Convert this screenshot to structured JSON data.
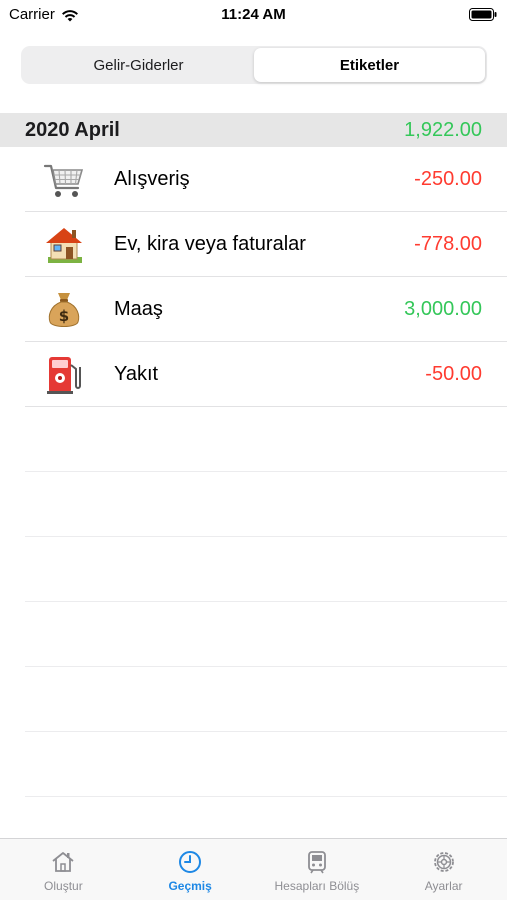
{
  "status_bar": {
    "carrier": "Carrier",
    "time": "11:24 AM"
  },
  "segments": [
    {
      "label": "Gelir-Giderler",
      "active": false
    },
    {
      "label": "Etiketler",
      "active": true
    }
  ],
  "section": {
    "title": "2020 April",
    "total": "1,922.00",
    "total_color": "#34c759"
  },
  "entries": [
    {
      "icon": "shopping-cart-icon",
      "label": "Alışveriş",
      "amount": "-250.00",
      "type": "negative"
    },
    {
      "icon": "house-icon",
      "label": "Ev, kira veya faturalar",
      "amount": "-778.00",
      "type": "negative"
    },
    {
      "icon": "money-bag-icon",
      "label": "Maaş",
      "amount": "3,000.00",
      "type": "positive"
    },
    {
      "icon": "fuel-pump-icon",
      "label": "Yakıt",
      "amount": "-50.00",
      "type": "negative"
    }
  ],
  "colors": {
    "negative": "#ff3b30",
    "positive": "#34c759",
    "accent": "#1e88e5"
  },
  "tabs": [
    {
      "label": "Oluştur",
      "icon": "home-icon",
      "active": false
    },
    {
      "label": "Geçmiş",
      "icon": "clock-icon",
      "active": true
    },
    {
      "label": "Hesapları Bölüş",
      "icon": "train-icon",
      "active": false
    },
    {
      "label": "Ayarlar",
      "icon": "gear-icon",
      "active": false
    }
  ]
}
